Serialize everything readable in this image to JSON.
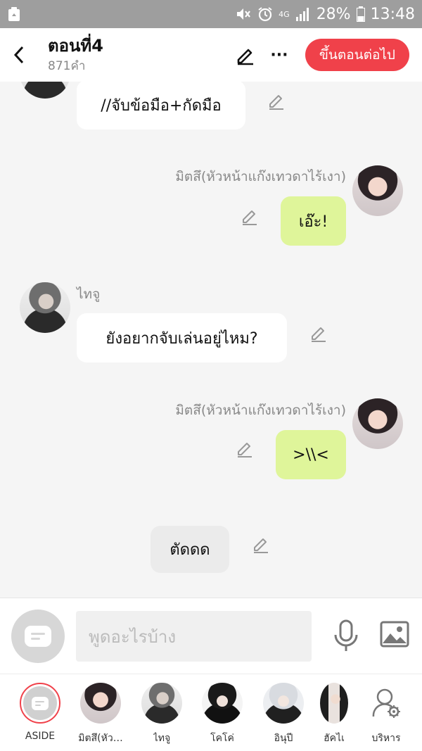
{
  "status_bar": {
    "battery_percent": "28%",
    "time": "13:48",
    "signal_label": "4G",
    "icons": [
      "recycle-icon",
      "mute-icon",
      "alarm-icon",
      "signal-icon",
      "battery-icon"
    ]
  },
  "header": {
    "title": "ตอนที่4",
    "word_count": "871คำ",
    "next_button": "ขึ้นตอนต่อไป",
    "more_glyph": "···"
  },
  "messages": [
    {
      "side": "left",
      "speaker": "",
      "text": "//จับข้อมือ+กัดมือ",
      "bubble_color": "#ffffff"
    },
    {
      "side": "right",
      "speaker": "มิตสึ(หัวหน้าแก๊งเทวดาไร้เงา)",
      "text": "เอ๊ะ!",
      "bubble_color": "#dff59a"
    },
    {
      "side": "left",
      "speaker": "ไทจู",
      "text": "ยังอยากจับเล่นอยู่ไหม?",
      "bubble_color": "#ffffff"
    },
    {
      "side": "right",
      "speaker": "มิตสึ(หัวหน้าแก๊งเทวดาไร้เงา)",
      "text": ">\\\\<",
      "bubble_color": "#dff59a"
    },
    {
      "side": "center",
      "speaker": "",
      "text": "ตัดดด",
      "bubble_color": "#ebebeb"
    }
  ],
  "composer": {
    "placeholder": "พูดอะไรบ้าง"
  },
  "characters": [
    {
      "label": "ASIDE",
      "icon": "aside-icon"
    },
    {
      "label": "มิตสึ(หัว…",
      "icon": "avatar"
    },
    {
      "label": "ไทจู",
      "icon": "avatar"
    },
    {
      "label": "โคโค่",
      "icon": "avatar"
    },
    {
      "label": "อินุปี",
      "icon": "avatar"
    },
    {
      "label": "ฮัคไเ",
      "icon": "avatar"
    },
    {
      "label": "บริหาร",
      "icon": "manage-user-icon"
    }
  ],
  "colors": {
    "accent_red": "#f0414a",
    "bubble_green": "#dff59a",
    "status_bar": "#9e9e9e",
    "chat_bg": "#f5f5f5"
  }
}
